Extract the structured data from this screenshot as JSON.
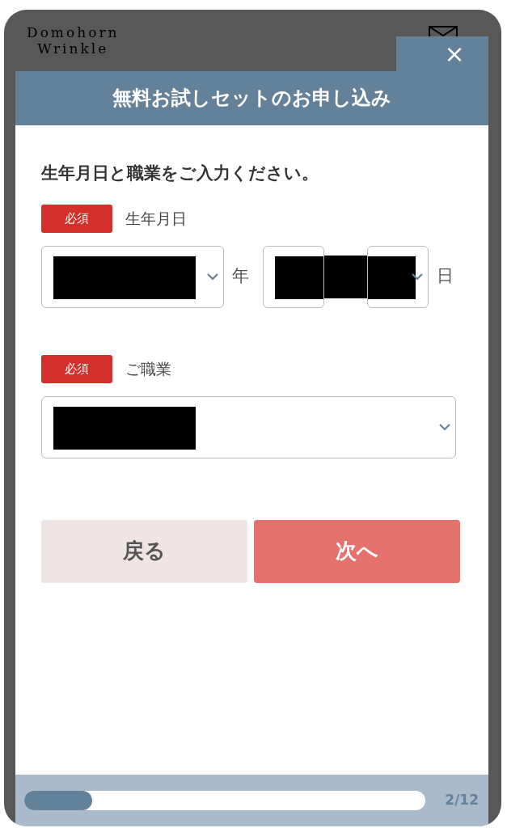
{
  "site_header": {
    "logo": [
      "Domohorn",
      "Wrinkle"
    ]
  },
  "modal": {
    "close": "×",
    "title": "無料お試しセットのお申し込み"
  },
  "heading": "生年月日と職業をご入力ください。",
  "fields": [
    {
      "kind": "date",
      "badge": "必須",
      "label": "生年月日",
      "selects": [
        {
          "suffix": "年",
          "redacted": true
        },
        {
          "redacted": true
        },
        {
          "suffix": "日"
        }
      ]
    },
    {
      "kind": "select",
      "badge": "必須",
      "label": "ご職業",
      "selects": [
        {
          "redacted": true
        }
      ]
    }
  ],
  "buttons": [
    {
      "kind": "back",
      "label": "戻る"
    },
    {
      "kind": "next",
      "label": "次へ"
    }
  ],
  "progress": {
    "level": 0.17,
    "reading": "2/12"
  }
}
